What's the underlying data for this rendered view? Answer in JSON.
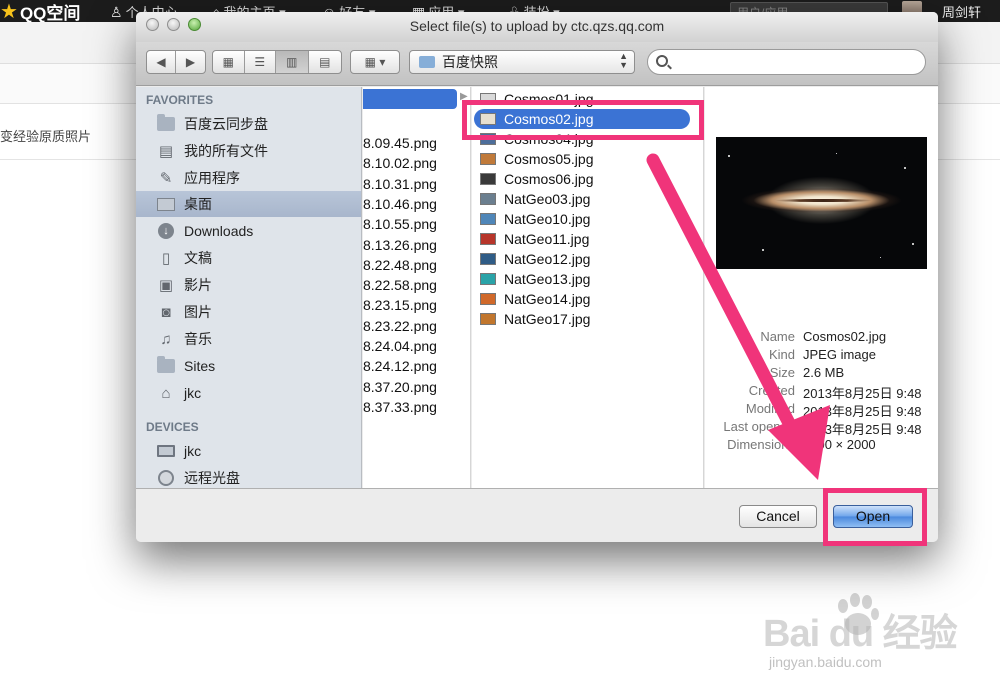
{
  "background": {
    "logo": "QQ空间",
    "nav": [
      {
        "icon": "person-icon",
        "glyph": "♙",
        "label": "个人中心"
      },
      {
        "icon": "home-icon",
        "glyph": "⌂",
        "label": "我的主页 ▾"
      },
      {
        "icon": "friends-icon",
        "glyph": "☺",
        "label": "好友 ▾"
      },
      {
        "icon": "apps-icon",
        "glyph": "▦",
        "label": "应用 ▾"
      },
      {
        "icon": "outfit-icon",
        "glyph": "♧",
        "label": "装扮 ▾"
      }
    ],
    "search_placeholder": "用户/应用",
    "username": "周剑轩",
    "crumb_text": "变经验原质照片"
  },
  "watermark": {
    "text": "Bai du 经验",
    "url": "jingyan.baidu.com"
  },
  "dialog": {
    "title": "Select file(s) to upload by ctc.qzs.qq.com",
    "location": "百度快照",
    "sidebar": {
      "favorites_header": "FAVORITES",
      "favorites": [
        {
          "icon": "folder-icon",
          "label": "百度云同步盘"
        },
        {
          "icon": "all-files-icon",
          "label": "我的所有文件"
        },
        {
          "icon": "applications-icon",
          "label": "应用程序"
        },
        {
          "icon": "desktop-icon",
          "label": "桌面"
        },
        {
          "icon": "downloads-icon",
          "label": "Downloads"
        },
        {
          "icon": "documents-icon",
          "label": "文稿"
        },
        {
          "icon": "movies-icon",
          "label": "影片"
        },
        {
          "icon": "pictures-icon",
          "label": "图片"
        },
        {
          "icon": "music-icon",
          "label": "音乐"
        },
        {
          "icon": "sites-icon",
          "label": "Sites"
        },
        {
          "icon": "home-icon",
          "label": "jkc"
        }
      ],
      "devices_header": "DEVICES",
      "devices": [
        {
          "icon": "computer-icon",
          "label": "jkc"
        },
        {
          "icon": "remote-disc-icon",
          "label": "远程光盘"
        }
      ]
    },
    "column_a": [
      "8.09.45.png",
      "8.10.02.png",
      "8.10.31.png",
      "8.10.46.png",
      "8.10.55.png",
      "8.13.26.png",
      "8.22.48.png",
      "8.22.58.png",
      "8.23.15.png",
      "8.23.22.png",
      "8.24.04.png",
      "8.24.12.png",
      "8.37.20.png",
      "8.37.33.png"
    ],
    "column_b": [
      {
        "name": "Cosmos01.jpg",
        "thumb": "#d9d9d9"
      },
      {
        "name": "Cosmos02.jpg",
        "thumb": "#e8e0d0",
        "selected": true
      },
      {
        "name": "Cosmos04.jpg",
        "thumb": "#4d6e9a"
      },
      {
        "name": "Cosmos05.jpg",
        "thumb": "#c07a3a"
      },
      {
        "name": "Cosmos06.jpg",
        "thumb": "#3a3a3a"
      },
      {
        "name": "NatGeo03.jpg",
        "thumb": "#6b7f8f"
      },
      {
        "name": "NatGeo10.jpg",
        "thumb": "#4f86b8"
      },
      {
        "name": "NatGeo11.jpg",
        "thumb": "#b7352a"
      },
      {
        "name": "NatGeo12.jpg",
        "thumb": "#2f5c86"
      },
      {
        "name": "NatGeo13.jpg",
        "thumb": "#2aa3a8"
      },
      {
        "name": "NatGeo14.jpg",
        "thumb": "#d0692a"
      },
      {
        "name": "NatGeo17.jpg",
        "thumb": "#c1762d"
      }
    ],
    "info": [
      {
        "key": "Name",
        "value": "Cosmos02.jpg"
      },
      {
        "key": "Kind",
        "value": "JPEG image"
      },
      {
        "key": "Size",
        "value": "2.6 MB"
      },
      {
        "key": "Created",
        "value": "2013年8月25日 9:48"
      },
      {
        "key": "Modified",
        "value": "2013年8月25日 9:48"
      },
      {
        "key": "Last opened",
        "value": "2013年8月25日 9:48"
      },
      {
        "key": "Dimensions",
        "value": "3200 × 2000"
      }
    ],
    "cancel_label": "Cancel",
    "open_label": "Open"
  },
  "annotation_color": "#f0347a",
  "selection_color": "#3b73d4"
}
